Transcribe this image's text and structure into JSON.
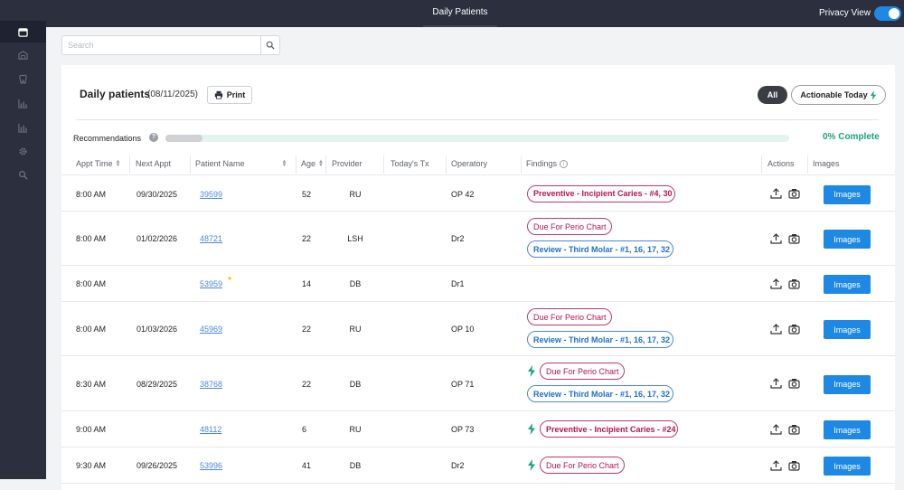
{
  "header": {
    "title": "Daily Patients",
    "privacy_label": "Privacy View",
    "privacy_on": true
  },
  "sidebar": {
    "icons": [
      "calendar-icon",
      "tooth-chart-icon",
      "tooth-icon",
      "chart-icon",
      "bar-chart-icon",
      "gear-icon",
      "search-icon"
    ]
  },
  "search": {
    "placeholder": "Search",
    "value": ""
  },
  "card": {
    "title": "Daily patients",
    "date": "(08/11/2025)",
    "print_label": "Print",
    "filter_all": "All",
    "filter_actionable": "Actionable Today"
  },
  "recommendations": {
    "label": "Recommendations",
    "help": "?",
    "progress_fraction": 0.06,
    "progress_text": "0% Complete"
  },
  "table": {
    "columns": {
      "appt_time": "Appt Time",
      "next_appt": "Next Appt",
      "patient_name": "Patient Name",
      "age": "Age",
      "provider": "Provider",
      "todays_tx": "Today's Tx",
      "operatory": "Operatory",
      "findings": "Findings",
      "actions": "Actions",
      "images": "Images"
    },
    "images_label": "Images",
    "rows": [
      {
        "appt": "8:00 AM",
        "next": "09/30/2025",
        "pid": "39599",
        "age": "52",
        "provider": "RU",
        "op": "OP 42",
        "findings": [
          {
            "text": "Preventive - Incipient Caries - #4, 30",
            "style": "red",
            "bolt": false
          }
        ]
      },
      {
        "appt": "8:00 AM",
        "next": "01/02/2026",
        "pid": "48721",
        "age": "22",
        "provider": "LSH",
        "op": "Dr2",
        "findings": [
          {
            "text": "Due For Perio Chart",
            "style": "pink",
            "bolt": false
          },
          {
            "text": "Review - Third Molar - #1, 16, 17, 32",
            "style": "blue",
            "bolt": false
          }
        ]
      },
      {
        "appt": "8:00 AM",
        "next": "",
        "pid": "53959",
        "star": true,
        "age": "14",
        "provider": "DB",
        "op": "Dr1",
        "findings": []
      },
      {
        "appt": "8:00 AM",
        "next": "01/03/2026",
        "pid": "45969",
        "age": "22",
        "provider": "RU",
        "op": "OP 10",
        "findings": [
          {
            "text": "Due For Perio Chart",
            "style": "pink",
            "bolt": false
          },
          {
            "text": "Review - Third Molar - #1, 16, 17, 32",
            "style": "blue",
            "bolt": false
          }
        ]
      },
      {
        "appt": "8:30 AM",
        "next": "08/29/2025",
        "pid": "38768",
        "age": "22",
        "provider": "DB",
        "op": "OP 71",
        "findings": [
          {
            "text": "Due For Perio Chart",
            "style": "pink",
            "bolt": true
          },
          {
            "text": "Review - Third Molar - #1, 16, 17, 32",
            "style": "blue",
            "bolt": false
          }
        ]
      },
      {
        "appt": "9:00 AM",
        "next": "",
        "pid": "48112",
        "age": "6",
        "provider": "RU",
        "op": "OP 73",
        "findings": [
          {
            "text": "Preventive - Incipient Caries - #24",
            "style": "red",
            "bolt": true
          }
        ]
      },
      {
        "appt": "9:30 AM",
        "next": "09/26/2025",
        "pid": "53996",
        "age": "41",
        "provider": "DB",
        "op": "Dr2",
        "findings": [
          {
            "text": "Due For Perio Chart",
            "style": "pink",
            "bolt": true
          }
        ]
      }
    ]
  }
}
